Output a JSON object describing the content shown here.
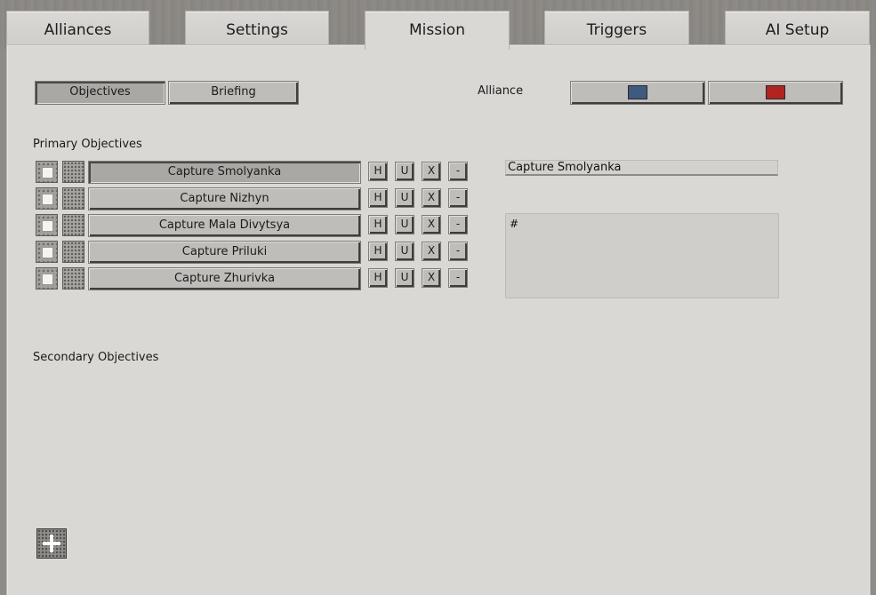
{
  "tabs": [
    {
      "label": "Alliances"
    },
    {
      "label": "Settings"
    },
    {
      "label": "Mission"
    },
    {
      "label": "Triggers"
    },
    {
      "label": "AI Setup"
    }
  ],
  "subtabs": {
    "objectives": "Objectives",
    "briefing": "Briefing"
  },
  "alliance": {
    "label": "Alliance",
    "colors": [
      "#3e5a80",
      "#b3231f"
    ]
  },
  "primary": {
    "heading": "Primary Objectives",
    "objectives": [
      {
        "name": "Capture Smolyanka"
      },
      {
        "name": "Capture Nizhyn"
      },
      {
        "name": "Capture Mala Divytsya"
      },
      {
        "name": "Capture Priluki"
      },
      {
        "name": "Capture Zhurivka"
      }
    ],
    "row_buttons": {
      "h": "H",
      "u": "U",
      "x": "X",
      "remove": "-"
    }
  },
  "detail": {
    "name_value": "Capture Smolyanka",
    "description_value": "#"
  },
  "secondary": {
    "heading": "Secondary Objectives"
  },
  "icons": {
    "add": "plus-icon"
  }
}
